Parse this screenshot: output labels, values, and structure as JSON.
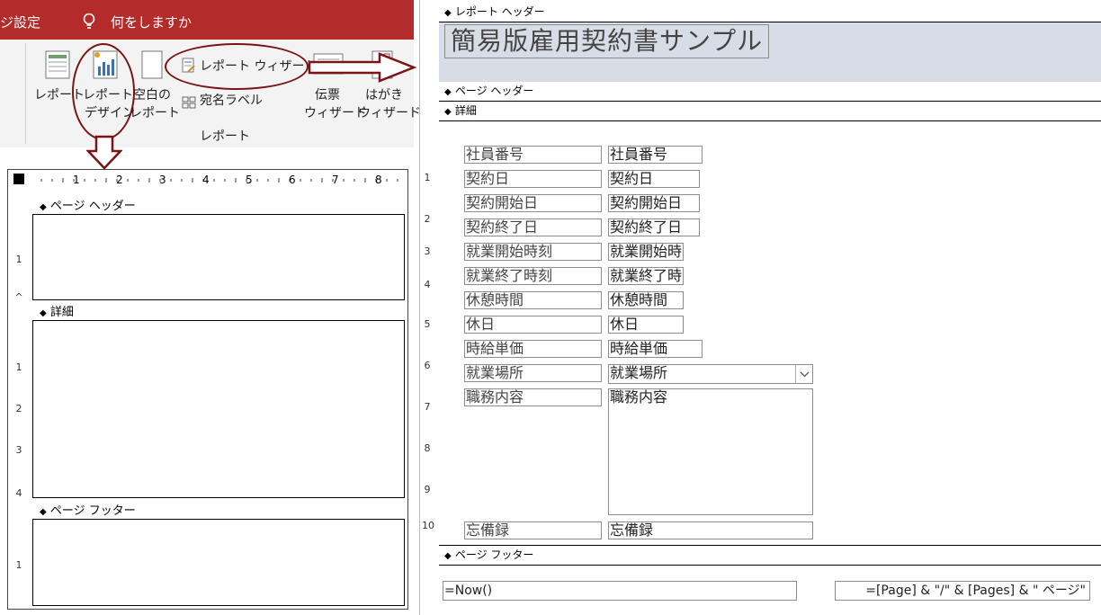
{
  "ribbon": {
    "tab_partial": "ジ設定",
    "tell_me": "何をしますか",
    "group_label": "レポート",
    "buttons": {
      "report": "レポート",
      "report_design_1": "レポート",
      "report_design_2": "デザイン",
      "blank_1": "空白の",
      "blank_2": "レポート",
      "wizard": "レポート ウィザード",
      "labels": "宛名ラベル",
      "slip_1": "伝票",
      "slip_2": "ウィザード",
      "postcard_1": "はがき",
      "postcard_2": "ウィザード"
    }
  },
  "left_design": {
    "ruler_numbers": [
      "1",
      "2",
      "3",
      "4",
      "5",
      "6",
      "7",
      "8"
    ],
    "sections": {
      "page_header": "ページ ヘッダー",
      "detail": "詳細",
      "page_footer": "ページ フッター"
    },
    "vruler": [
      "1",
      "^",
      "1",
      "2",
      "3",
      "4",
      "1"
    ]
  },
  "right_design": {
    "sections": {
      "report_header": "レポート ヘッダー",
      "page_header": "ページ ヘッダー",
      "detail": "詳細",
      "page_footer": "ページ フッター"
    },
    "title": "簡易版雇用契約書サンプル",
    "vruler": [
      "1",
      "2",
      "3",
      "4",
      "5",
      "6",
      "7",
      "8",
      "9",
      "10"
    ],
    "fields": [
      {
        "label": "社員番号",
        "value": "社員番号"
      },
      {
        "label": "契約日",
        "value": "契約日"
      },
      {
        "label": "契約開始日",
        "value": "契約開始日"
      },
      {
        "label": "契約終了日",
        "value": "契約終了日"
      },
      {
        "label": "就業開始時刻",
        "value": "就業開始時"
      },
      {
        "label": "就業終了時刻",
        "value": "就業終了時"
      },
      {
        "label": "休憩時間",
        "value": "休憩時間"
      },
      {
        "label": "休日",
        "value": "休日"
      },
      {
        "label": "時給単価",
        "value": "時給単価"
      },
      {
        "label": "就業場所",
        "value": "就業場所"
      },
      {
        "label": "職務内容",
        "value": "職務内容"
      },
      {
        "label": "忘備録",
        "value": "忘備録"
      }
    ],
    "footer": {
      "now": "=Now()",
      "pages": "=[Page] & \"/\" & [Pages] & \" ページ\""
    }
  },
  "colors": {
    "ribbon_red": "#b42b2b",
    "annotation": "#7a1515",
    "header_band": "#d7dce6"
  }
}
